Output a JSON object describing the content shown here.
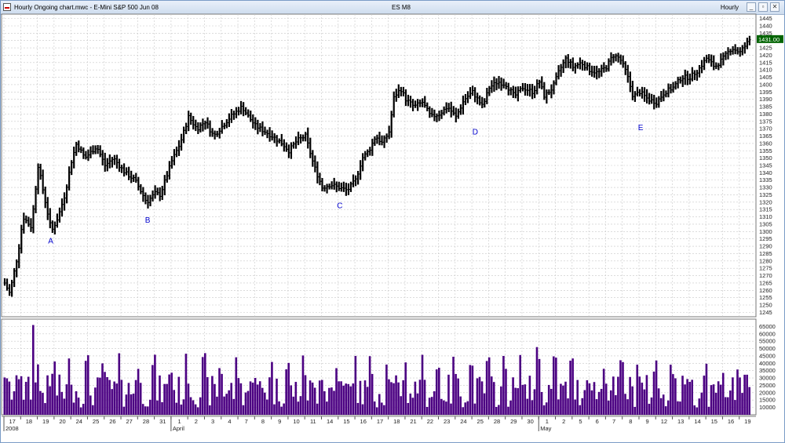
{
  "window": {
    "title": "Hourly Ongoing chart.mwc - E-Mini S&P 500 Jun 08",
    "symbol": "ES M8",
    "interval": "Hourly",
    "buttons": {
      "minimize": "_",
      "restore": "▫",
      "close": "✕"
    }
  },
  "colors": {
    "price_bar": "#000000",
    "volume_bar": "#4b0082",
    "last_price_bg": "#006400",
    "last_price_text": "#ffffff",
    "annotation": "#0000cc",
    "grid": "#c8c8c8"
  },
  "chart_data": [
    {
      "type": "bar",
      "subtype": "OHLC hourly price",
      "title": "",
      "ylim": [
        1242,
        1448
      ],
      "ytick_labels": [
        "1445",
        "1440",
        "1435",
        "1430",
        "1425",
        "1420",
        "1415",
        "1410",
        "1405",
        "1400",
        "1395",
        "1390",
        "1385",
        "1380",
        "1375",
        "1370",
        "1365",
        "1360",
        "1355",
        "1350",
        "1345",
        "1340",
        "1335",
        "1330",
        "1325",
        "1320",
        "1315",
        "1310",
        "1305",
        "1300",
        "1295",
        "1290",
        "1285",
        "1280",
        "1275",
        "1270",
        "1265",
        "1260",
        "1255",
        "1250",
        "1245"
      ],
      "last_price": "1431.00",
      "x_date_labels": [
        "17",
        "18",
        "19",
        "20",
        "24",
        "25",
        "26",
        "27",
        "28",
        "31",
        "1",
        "2",
        "3",
        "4",
        "7",
        "8",
        "9",
        "10",
        "11",
        "14",
        "15",
        "16",
        "17",
        "18",
        "21",
        "22",
        "23",
        "24",
        "25",
        "28",
        "29",
        "30",
        "1",
        "2",
        "5",
        "6",
        "7",
        "8",
        "9",
        "12",
        "13",
        "14",
        "15",
        "16",
        "19"
      ],
      "x_month_labels": [
        "2008",
        "April",
        "May"
      ],
      "anchors": [
        {
          "day": 0,
          "p": 1265
        },
        {
          "day": 0.3,
          "p": 1258
        },
        {
          "day": 0.8,
          "p": 1285
        },
        {
          "day": 1.1,
          "p": 1310
        },
        {
          "day": 1.6,
          "p": 1303
        },
        {
          "day": 2.0,
          "p": 1345
        },
        {
          "day": 2.4,
          "p": 1322
        },
        {
          "day": 2.8,
          "p": 1300
        },
        {
          "day": 3.2,
          "p": 1310
        },
        {
          "day": 3.6,
          "p": 1325
        },
        {
          "day": 4.0,
          "p": 1348
        },
        {
          "day": 4.3,
          "p": 1360
        },
        {
          "day": 4.8,
          "p": 1350
        },
        {
          "day": 5.5,
          "p": 1358
        },
        {
          "day": 6.0,
          "p": 1345
        },
        {
          "day": 6.5,
          "p": 1350
        },
        {
          "day": 7.2,
          "p": 1340
        },
        {
          "day": 7.8,
          "p": 1335
        },
        {
          "day": 8.5,
          "p": 1320
        },
        {
          "day": 9.0,
          "p": 1326
        },
        {
          "day": 9.3,
          "p": 1325
        },
        {
          "day": 10.0,
          "p": 1348
        },
        {
          "day": 10.5,
          "p": 1360
        },
        {
          "day": 11.0,
          "p": 1378
        },
        {
          "day": 11.5,
          "p": 1370
        },
        {
          "day": 12.0,
          "p": 1375
        },
        {
          "day": 12.5,
          "p": 1365
        },
        {
          "day": 13.5,
          "p": 1378
        },
        {
          "day": 14.2,
          "p": 1385
        },
        {
          "day": 14.6,
          "p": 1378
        },
        {
          "day": 15.0,
          "p": 1372
        },
        {
          "day": 16.0,
          "p": 1365
        },
        {
          "day": 16.6,
          "p": 1360
        },
        {
          "day": 17.0,
          "p": 1355
        },
        {
          "day": 17.5,
          "p": 1362
        },
        {
          "day": 18.0,
          "p": 1365
        },
        {
          "day": 18.5,
          "p": 1345
        },
        {
          "day": 19.0,
          "p": 1330
        },
        {
          "day": 19.5,
          "p": 1332
        },
        {
          "day": 20.0,
          "p": 1330
        },
        {
          "day": 20.5,
          "p": 1328
        },
        {
          "day": 21.0,
          "p": 1335
        },
        {
          "day": 21.4,
          "p": 1350
        },
        {
          "day": 21.8,
          "p": 1355
        },
        {
          "day": 22.2,
          "p": 1365
        },
        {
          "day": 22.6,
          "p": 1360
        },
        {
          "day": 23.0,
          "p": 1368
        },
        {
          "day": 23.3,
          "p": 1392
        },
        {
          "day": 23.7,
          "p": 1397
        },
        {
          "day": 24.0,
          "p": 1390
        },
        {
          "day": 24.5,
          "p": 1385
        },
        {
          "day": 25.0,
          "p": 1388
        },
        {
          "day": 25.5,
          "p": 1378
        },
        {
          "day": 26.0,
          "p": 1380
        },
        {
          "day": 26.5,
          "p": 1385
        },
        {
          "day": 27.0,
          "p": 1378
        },
        {
          "day": 27.5,
          "p": 1390
        },
        {
          "day": 28.0,
          "p": 1395
        },
        {
          "day": 28.6,
          "p": 1385
        },
        {
          "day": 29.0,
          "p": 1398
        },
        {
          "day": 29.5,
          "p": 1402
        },
        {
          "day": 30.0,
          "p": 1400
        },
        {
          "day": 30.5,
          "p": 1392
        },
        {
          "day": 31.0,
          "p": 1398
        },
        {
          "day": 31.6,
          "p": 1395
        },
        {
          "day": 32.0,
          "p": 1402
        },
        {
          "day": 32.3,
          "p": 1392
        },
        {
          "day": 32.8,
          "p": 1398
        },
        {
          "day": 33.2,
          "p": 1410
        },
        {
          "day": 33.6,
          "p": 1418
        },
        {
          "day": 34.0,
          "p": 1412
        },
        {
          "day": 34.5,
          "p": 1415
        },
        {
          "day": 35.0,
          "p": 1410
        },
        {
          "day": 35.5,
          "p": 1408
        },
        {
          "day": 36.0,
          "p": 1412
        },
        {
          "day": 36.4,
          "p": 1420
        },
        {
          "day": 36.8,
          "p": 1418
        },
        {
          "day": 37.2,
          "p": 1408
        },
        {
          "day": 37.6,
          "p": 1392
        },
        {
          "day": 38.0,
          "p": 1395
        },
        {
          "day": 38.5,
          "p": 1390
        },
        {
          "day": 39.0,
          "p": 1388
        },
        {
          "day": 39.5,
          "p": 1395
        },
        {
          "day": 40.0,
          "p": 1398
        },
        {
          "day": 40.5,
          "p": 1405
        },
        {
          "day": 41.0,
          "p": 1405
        },
        {
          "day": 41.5,
          "p": 1410
        },
        {
          "day": 42.0,
          "p": 1418
        },
        {
          "day": 42.5,
          "p": 1412
        },
        {
          "day": 43.0,
          "p": 1418
        },
        {
          "day": 43.5,
          "p": 1425
        },
        {
          "day": 44.0,
          "p": 1422
        },
        {
          "day": 44.4,
          "p": 1428
        },
        {
          "day": 44.6,
          "p": 1431
        }
      ],
      "annotations": [
        {
          "label": "A",
          "day": 2.8,
          "price": 1292
        },
        {
          "label": "B",
          "day": 8.6,
          "price": 1306
        },
        {
          "label": "C",
          "day": 20.1,
          "price": 1316
        },
        {
          "label": "D",
          "day": 28.2,
          "price": 1366
        },
        {
          "label": "E",
          "day": 38.1,
          "price": 1369
        }
      ]
    },
    {
      "type": "bar",
      "subtype": "volume",
      "ylim": [
        5000,
        70000
      ],
      "ytick_labels": [
        "65000",
        "60000",
        "55000",
        "50000",
        "45000",
        "40000",
        "35000",
        "30000",
        "25000",
        "20000",
        "15000",
        "10000"
      ],
      "typical_range": [
        10000,
        40000
      ],
      "spikes": [
        {
          "day": 1.7,
          "value": 66000
        },
        {
          "day": 31.9,
          "value": 51000
        },
        {
          "day": 21.0,
          "value": 45000
        }
      ]
    }
  ]
}
